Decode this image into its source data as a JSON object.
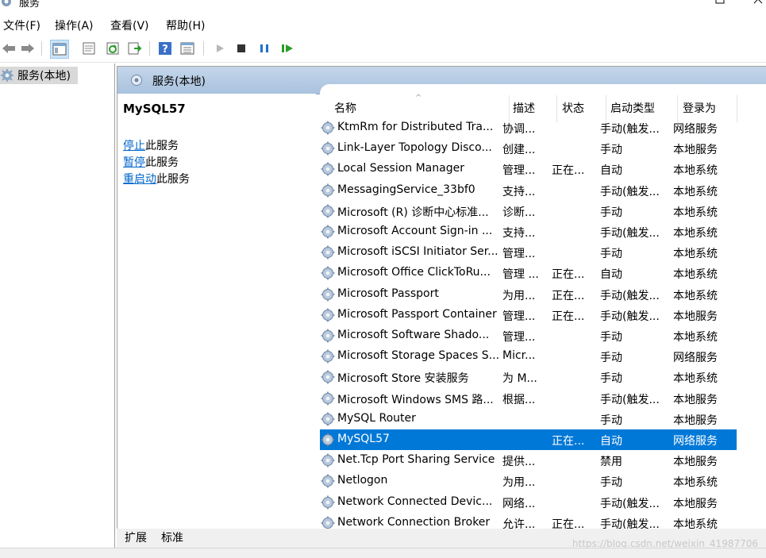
{
  "window": {
    "title": "服务"
  },
  "menu": [
    "文件(F)",
    "操作(A)",
    "查看(V)",
    "帮助(H)"
  ],
  "toolbar": {
    "buttons": [
      "back-arrow-icon",
      "forward-arrow-icon",
      "show-hide-console-tree-icon",
      "properties-icon",
      "refresh-icon",
      "export-list-icon",
      "help-icon",
      "view-icon",
      "start-service-icon",
      "stop-service-icon",
      "pause-service-icon",
      "restart-service-icon"
    ]
  },
  "tree": {
    "root_label": "服务(本地)"
  },
  "panel": {
    "header_label": "服务(本地)",
    "selected_service": "MySQL57",
    "actions": [
      {
        "link": "停止",
        "rest": "此服务"
      },
      {
        "link": "暂停",
        "rest": "此服务"
      },
      {
        "link": "重启动",
        "rest": "此服务"
      }
    ]
  },
  "list": {
    "columns": [
      "名称",
      "描述",
      "状态",
      "启动类型",
      "登录为"
    ],
    "rows": [
      {
        "name": "KtmRm for Distributed Tra...",
        "desc": "协调...",
        "status": "",
        "startup": "手动(触发...",
        "logon": "网络服务"
      },
      {
        "name": "Link-Layer Topology Disco...",
        "desc": "创建...",
        "status": "",
        "startup": "手动",
        "logon": "本地服务"
      },
      {
        "name": "Local Session Manager",
        "desc": "管理...",
        "status": "正在...",
        "startup": "自动",
        "logon": "本地系统"
      },
      {
        "name": "MessagingService_33bf0",
        "desc": "支持...",
        "status": "",
        "startup": "手动(触发...",
        "logon": "本地系统"
      },
      {
        "name": "Microsoft (R) 诊断中心标准...",
        "desc": "诊断...",
        "status": "",
        "startup": "手动",
        "logon": "本地系统"
      },
      {
        "name": "Microsoft Account Sign-in ...",
        "desc": "支持...",
        "status": "",
        "startup": "手动(触发...",
        "logon": "本地系统"
      },
      {
        "name": "Microsoft iSCSI Initiator Ser...",
        "desc": "管理...",
        "status": "",
        "startup": "手动",
        "logon": "本地系统"
      },
      {
        "name": "Microsoft Office ClickToRu...",
        "desc": "管理 ...",
        "status": "正在...",
        "startup": "自动",
        "logon": "本地系统"
      },
      {
        "name": "Microsoft Passport",
        "desc": "为用...",
        "status": "正在...",
        "startup": "手动(触发...",
        "logon": "本地系统"
      },
      {
        "name": "Microsoft Passport Container",
        "desc": "管理...",
        "status": "正在...",
        "startup": "手动(触发...",
        "logon": "本地服务"
      },
      {
        "name": "Microsoft Software Shado...",
        "desc": "管理...",
        "status": "",
        "startup": "手动",
        "logon": "本地系统"
      },
      {
        "name": "Microsoft Storage Spaces S...",
        "desc": "Micr...",
        "status": "",
        "startup": "手动",
        "logon": "网络服务"
      },
      {
        "name": "Microsoft Store 安装服务",
        "desc": "为 M...",
        "status": "",
        "startup": "手动",
        "logon": "本地系统"
      },
      {
        "name": "Microsoft Windows SMS 路...",
        "desc": "根据...",
        "status": "",
        "startup": "手动(触发...",
        "logon": "本地服务"
      },
      {
        "name": "MySQL Router",
        "desc": "",
        "status": "",
        "startup": "手动",
        "logon": "本地服务"
      },
      {
        "name": "MySQL57",
        "desc": "",
        "status": "正在...",
        "startup": "自动",
        "logon": "网络服务",
        "selected": true
      },
      {
        "name": "Net.Tcp Port Sharing Service",
        "desc": "提供...",
        "status": "",
        "startup": "禁用",
        "logon": "本地服务"
      },
      {
        "name": "Netlogon",
        "desc": "为用...",
        "status": "",
        "startup": "手动",
        "logon": "本地系统"
      },
      {
        "name": "Network Connected Devic...",
        "desc": "网络...",
        "status": "",
        "startup": "手动(触发...",
        "logon": "本地服务"
      },
      {
        "name": "Network Connection Broker",
        "desc": "允许...",
        "status": "正在...",
        "startup": "手动(触发...",
        "logon": "本地系统"
      }
    ]
  },
  "tabs": [
    "扩展",
    "标准"
  ],
  "watermark": "https://blog.csdn.net/weixin_41987706",
  "colors": {
    "selection": "#0078d7",
    "link": "#0066cc",
    "header_band": "#b8cde4"
  }
}
